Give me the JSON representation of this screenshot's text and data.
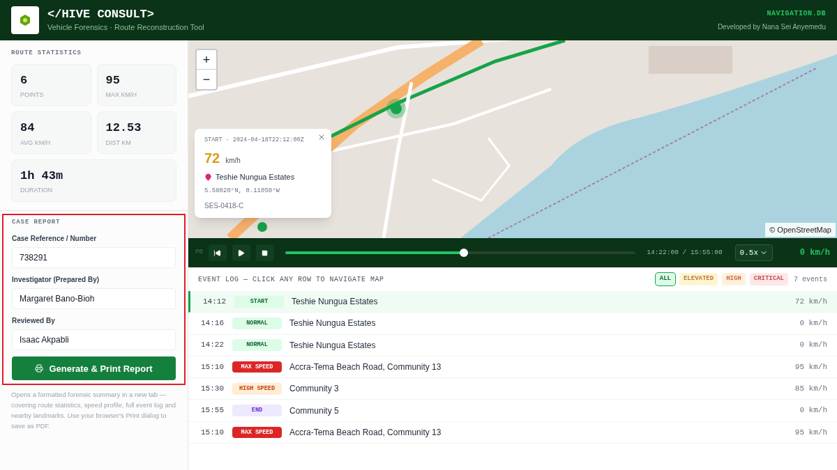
{
  "header": {
    "title": "</HIVE CONSULT>",
    "subtitle": "Vehicle Forensics · Route Reconstruction Tool",
    "badge": "NAVIGATION.DB",
    "credit": "Developed by Nana Sei Anyemedu"
  },
  "route_statistics": {
    "title": "ROUTE STATISTICS",
    "stats": [
      {
        "value": "6",
        "label": "POINTS"
      },
      {
        "value": "95",
        "label": "MAX KM/H"
      },
      {
        "value": "84",
        "label": "AVG KM/H"
      },
      {
        "value": "12.53",
        "label": "DIST KM"
      },
      {
        "value": "1h 43m",
        "label": "DURATION"
      }
    ]
  },
  "case_report": {
    "title": "CASE REPORT",
    "highlighted": true,
    "fields": [
      {
        "label": "Case Reference / Number",
        "value": "738291"
      },
      {
        "label": "Investigator (Prepared By)",
        "value": "Margaret Bano-Bioh"
      },
      {
        "label": "Reviewed By",
        "value": "Isaac Akpabli"
      }
    ],
    "button": "Generate & Print Report",
    "note": "Opens a formatted forensic summary in a new tab — covering route statistics, speed profile, full event log and nearby landmarks. Use your browser's Print dialog to save as PDF."
  },
  "map": {
    "zoom_in": "+",
    "zoom_out": "−",
    "attribution": "© OpenStreetMap",
    "popup": {
      "header": "START · 2024-04-18T22:12:00Z",
      "speed": "72",
      "unit": "km/h",
      "place": "Teshie Nungua Estates",
      "coords": "5.58020°N, 0.11050°W",
      "code": "SES-0418-C"
    }
  },
  "playback": {
    "label": "PB",
    "level": 0.51,
    "time": "14:22:00 / 15:55:00",
    "rate": "0.5x",
    "speed": "0 km/h"
  },
  "event_log": {
    "title": "EVENT LOG — CLICK ANY ROW TO NAVIGATE MAP",
    "count": "7 events",
    "filters": [
      {
        "label": "ALL",
        "kind": "all",
        "selected": true
      },
      {
        "label": "ELEVATED",
        "kind": "elevated",
        "selected": false
      },
      {
        "label": "HIGH",
        "kind": "high",
        "selected": false
      },
      {
        "label": "CRITICAL",
        "kind": "critical",
        "selected": false
      }
    ],
    "rows": [
      {
        "time": "14:12",
        "tag": "START",
        "kind": "start",
        "place": "Teshie Nungua Estates",
        "speed": "72 km/h",
        "selected": true
      },
      {
        "time": "14:16",
        "tag": "NORMAL",
        "kind": "normal",
        "place": "Teshie Nungua Estates",
        "speed": "0 km/h",
        "selected": false
      },
      {
        "time": "14:22",
        "tag": "NORMAL",
        "kind": "normal",
        "place": "Teshie Nungua Estates",
        "speed": "0 km/h",
        "selected": false
      },
      {
        "time": "15:10",
        "tag": "MAX SPEED",
        "kind": "max",
        "place": "Accra-Tema Beach Road, Community 13",
        "speed": "95 km/h",
        "selected": false
      },
      {
        "time": "15:30",
        "tag": "HIGH SPEED",
        "kind": "high",
        "place": "Community 3",
        "speed": "85 km/h",
        "selected": false
      },
      {
        "time": "15:55",
        "tag": "END",
        "kind": "end",
        "place": "Community 5",
        "speed": "0 km/h",
        "selected": false
      },
      {
        "time": "15:10",
        "tag": "MAX SPEED",
        "kind": "max",
        "place": "Accra-Tema Beach Road, Community 13",
        "speed": "95 km/h",
        "selected": false
      }
    ]
  }
}
